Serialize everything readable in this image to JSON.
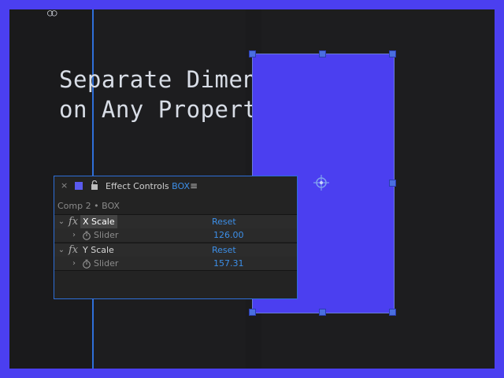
{
  "headline": {
    "line1": "Separate Dimensions",
    "line2": "on Any Property"
  },
  "icons": {
    "guide": "link-icon",
    "close": "close-icon",
    "swatch": "layer-color-swatch",
    "lock": "lock-icon",
    "menu": "hamburger-menu-icon",
    "anchor": "anchor-point-icon",
    "expand": "chevron-icon",
    "effect": "fx-icon",
    "stopwatch": "stopwatch-icon"
  },
  "panel": {
    "close_glyph": "×",
    "title": "Effect Controls",
    "layer_name": "BOX",
    "menu_glyph": "≡",
    "breadcrumb": "Comp 2 • BOX",
    "effects": [
      {
        "name": "X Scale",
        "reset_label": "Reset",
        "param_label": "Slider",
        "value": "126.00",
        "selected": true
      },
      {
        "name": "Y Scale",
        "reset_label": "Reset",
        "param_label": "Slider",
        "value": "157.31",
        "selected": false
      }
    ]
  },
  "colors": {
    "accent_purple": "#4b3ff0",
    "accent_blue": "#3d8fe8",
    "guide_blue": "#2f6fd8",
    "canvas_bg": "#1d1d1f",
    "panel_bg": "#232323"
  }
}
